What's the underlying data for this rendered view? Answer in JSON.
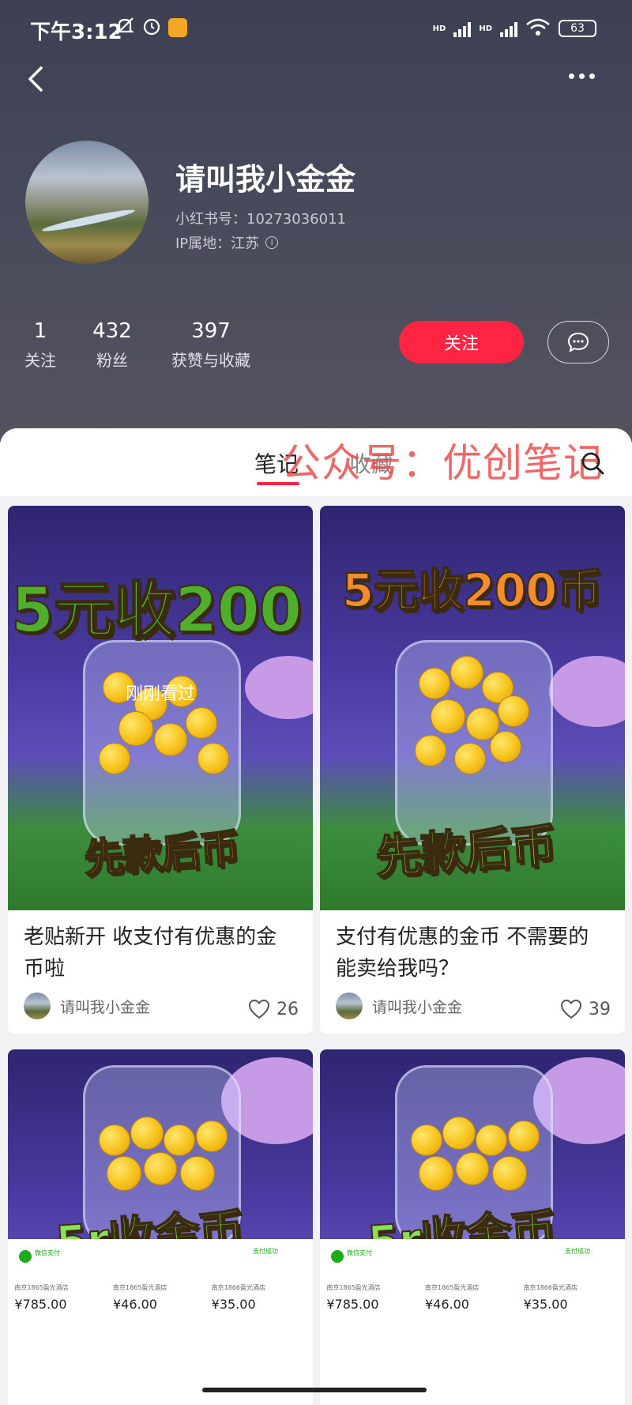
{
  "status_bar": {
    "time": "下午3:12",
    "left_icons": [
      "bell-off-icon",
      "alarm-icon",
      "app-badge-icon"
    ],
    "network_left": "HD",
    "network_right": "HD",
    "battery": "63"
  },
  "profile": {
    "nickname": "请叫我小金金",
    "red_id": "小红书号：10273036011",
    "ip_location": "IP属地：江苏",
    "stats": [
      {
        "value": "1",
        "label": "关注"
      },
      {
        "value": "432",
        "label": "粉丝"
      },
      {
        "value": "397",
        "label": "获赞与收藏"
      }
    ],
    "follow_label": "关注"
  },
  "tabs": {
    "notes": "笔记",
    "collections": "收藏"
  },
  "watermark": "公众号：优创笔记",
  "colors": {
    "accent": "#ff2442",
    "header_bg": "#43465a"
  },
  "notes": [
    {
      "image_headline": "5元收200",
      "image_subline": "先款后币",
      "seen_label": "刚刚看过",
      "title": "老贴新开 收支付有优惠的金币啦",
      "author": "请叫我小金金",
      "likes": "26"
    },
    {
      "image_headline": "5元收200币",
      "image_subline": "先款后币",
      "title": "支付有优惠的金币 不需要的能卖给我吗？",
      "author": "请叫我小金金",
      "likes": "39"
    },
    {
      "image_headline": "5r收金币",
      "receipt": {
        "pay_tag": "微信支付",
        "pay_status": "支付成功",
        "stores": [
          "南京1865盈光酒店",
          "南京1865盈光酒店",
          "南京1866盈光酒店"
        ],
        "prices": [
          "¥785.00",
          "¥46.00",
          "¥35.00"
        ]
      }
    },
    {
      "image_headline": "5r收金币",
      "receipt": {
        "pay_tag": "微信支付",
        "pay_status": "支付成功",
        "stores": [
          "南京1865盈光酒店",
          "南京1865盈光酒店",
          "南京1866盈光酒店"
        ],
        "prices": [
          "¥785.00",
          "¥46.00",
          "¥35.00"
        ]
      }
    }
  ]
}
